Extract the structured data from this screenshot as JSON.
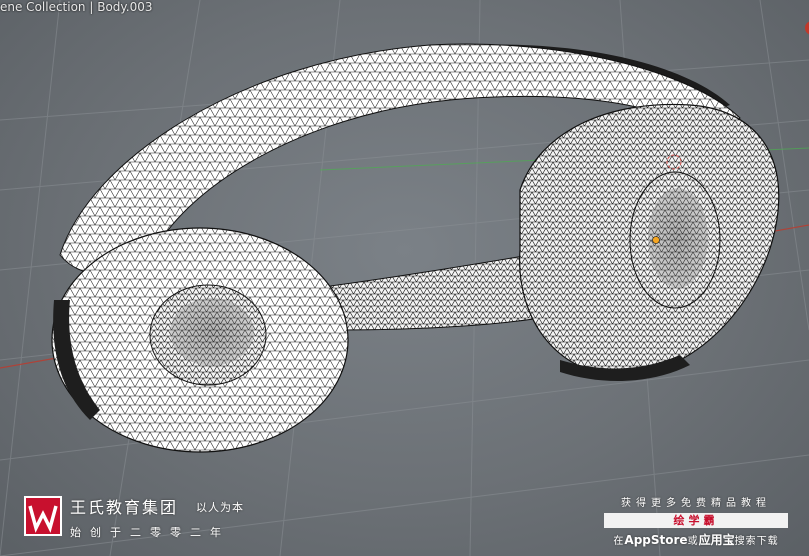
{
  "viewport": {
    "object_label": "ene Collection | Body.003",
    "origin_color": "#f5a623",
    "x_axis_color": "#c0392b",
    "y_axis_color": "#4caf50"
  },
  "watermark_left": {
    "logo_letter": "W",
    "brand_name": "王氏教育集团",
    "motto": "以人为本",
    "founded": "始创于二零零二年"
  },
  "watermark_right": {
    "top_line": "获得更多免费精品教程",
    "banner": "绘学霸",
    "bottom_prefix": "在",
    "bottom_app": "AppStore",
    "bottom_or": "或",
    "bottom_store": "应用宝",
    "bottom_suffix": "搜索下载"
  }
}
